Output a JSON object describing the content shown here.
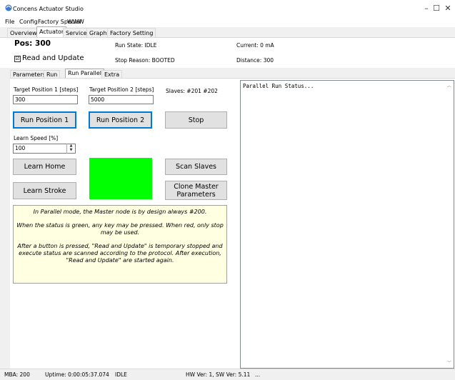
{
  "window": {
    "title": "Concens Actuator Studio",
    "minimize": "–",
    "maximize": "☐",
    "close": "✕"
  },
  "menu": [
    "File",
    "Config",
    "Factory Special",
    "WWW"
  ],
  "main_tabs": [
    "Overview",
    "Actuator",
    "Service",
    "Graph",
    "Factory Setting"
  ],
  "header": {
    "pos": "Pos: 300",
    "run_state": "Run State: IDLE",
    "current": "Current: 0 mA",
    "read_update_label": "Read and Update",
    "read_update_checked": "☑",
    "stop_reason": "Stop Reason: BOOTED",
    "distance": "Distance: 300"
  },
  "sub_tabs": [
    "Parameters",
    "Run",
    "Run Parallel",
    "Extra"
  ],
  "run_parallel": {
    "target1_label": "Target Position 1 [steps]",
    "target1_value": "300",
    "target2_label": "Target Position 2 [steps]",
    "target2_value": "5000",
    "slaves": "Slaves: #201 #202",
    "btn_run1": "Run Position 1",
    "btn_run2": "Run Position 2",
    "btn_stop": "Stop",
    "learn_speed_label": "Learn Speed [%]",
    "learn_speed_value": "100",
    "btn_learn_home": "Learn Home",
    "btn_scan_slaves": "Scan Slaves",
    "btn_learn_stroke": "Learn Stroke",
    "btn_clone": "Clone Master Parameters",
    "status_color": "#00ff00",
    "info_para1": "In Parallel mode, the Master node is by design always #200.",
    "info_para2": "When the status is green, any key may be pressed. When red, only stop may be used.",
    "info_para3": "After a button is pressed, \"Read and Update\" is temporary stopped and execute status are scanned according to the protocol. After execution, \"Read and Update\" are started again.",
    "log_text": "Parallel Run Status..."
  },
  "statusbar": {
    "mba": "MBA: 200",
    "uptime": "Uptime: 0:00:05:37.074",
    "state": "IDLE",
    "version": "HW Ver: 1, SW Ver: 5.11",
    "extra": "..."
  }
}
